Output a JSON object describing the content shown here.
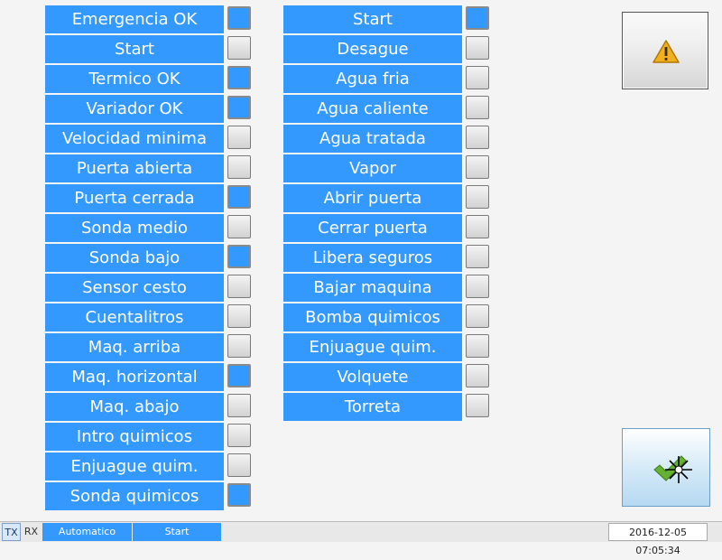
{
  "inputs": [
    {
      "label": "Emergencia OK",
      "active": true
    },
    {
      "label": "Start",
      "active": false
    },
    {
      "label": "Termico OK",
      "active": true
    },
    {
      "label": "Variador OK",
      "active": true
    },
    {
      "label": "Velocidad minima",
      "active": false
    },
    {
      "label": "Puerta abierta",
      "active": false
    },
    {
      "label": "Puerta cerrada",
      "active": true
    },
    {
      "label": "Sonda medio",
      "active": false
    },
    {
      "label": "Sonda bajo",
      "active": true
    },
    {
      "label": "Sensor cesto",
      "active": false
    },
    {
      "label": "Cuentalitros",
      "active": false
    },
    {
      "label": "Maq. arriba",
      "active": false
    },
    {
      "label": "Maq. horizontal",
      "active": true
    },
    {
      "label": "Maq. abajo",
      "active": false
    },
    {
      "label": "Intro quimicos",
      "active": false
    },
    {
      "label": "Enjuague quim.",
      "active": false
    },
    {
      "label": "Sonda quimicos",
      "active": true
    }
  ],
  "outputs": [
    {
      "label": "Start",
      "active": true
    },
    {
      "label": "Desague",
      "active": false
    },
    {
      "label": "Agua fria",
      "active": false
    },
    {
      "label": "Agua caliente",
      "active": false
    },
    {
      "label": "Agua tratada",
      "active": false
    },
    {
      "label": "Vapor",
      "active": false
    },
    {
      "label": "Abrir puerta",
      "active": false
    },
    {
      "label": "Cerrar puerta",
      "active": false
    },
    {
      "label": "Libera seguros",
      "active": false
    },
    {
      "label": "Bajar maquina",
      "active": false
    },
    {
      "label": "Bomba quimicos",
      "active": false
    },
    {
      "label": "Enjuague quim.",
      "active": false
    },
    {
      "label": "Volquete",
      "active": false
    },
    {
      "label": "Torreta",
      "active": false
    }
  ],
  "buttons": {
    "warning_icon": "warning-triangle-icon",
    "confirm_icon": "checkmark-icon"
  },
  "status_bar": {
    "tx": "TX",
    "rx": "RX",
    "mode": "Automatico",
    "state": "Start",
    "datetime": "2016-12-05 07:05:34"
  },
  "colors": {
    "accent": "#3399ff",
    "label_text": "#ffffff",
    "indicator_off": "#d6d6d6",
    "warning": "#f2b01e",
    "check": "#66b032"
  }
}
